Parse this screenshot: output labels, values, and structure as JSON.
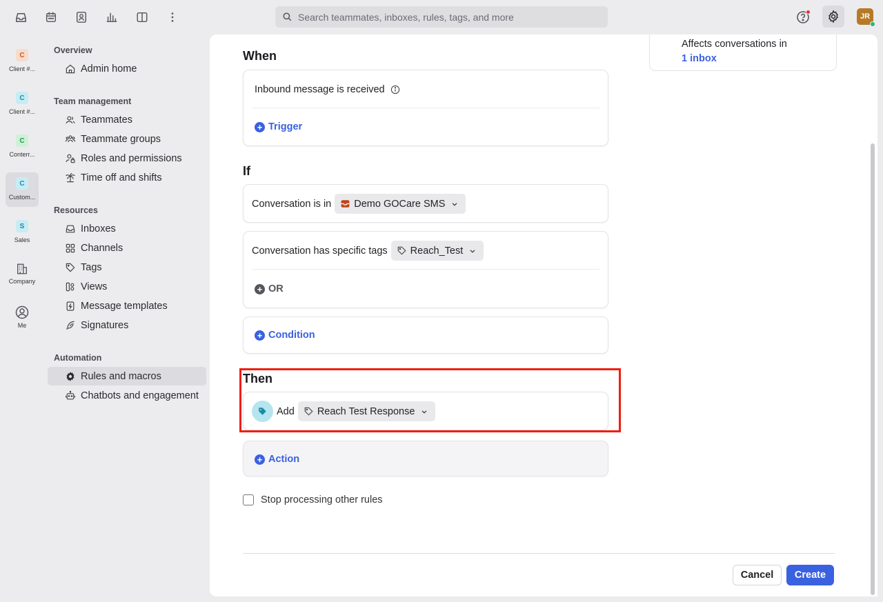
{
  "search": {
    "placeholder": "Search teammates, inboxes, rules, tags, and more"
  },
  "user": {
    "initials": "JR"
  },
  "workspaces": [
    {
      "badge": "C",
      "label": "Client #...",
      "color": "#f4d7c8",
      "text": "#d6521b"
    },
    {
      "badge": "C",
      "label": "Client #...",
      "color": "#c8ecf3",
      "text": "#1b8aa8"
    },
    {
      "badge": "C",
      "label": "Conterr...",
      "color": "#d0f0d8",
      "text": "#1f9a45"
    },
    {
      "badge": "C",
      "label": "Custom...",
      "color": "#c8ecf3",
      "text": "#1b8aa8"
    },
    {
      "badge": "S",
      "label": "Sales",
      "color": "#c8ecf3",
      "text": "#1b8aa8"
    },
    {
      "label": "Company"
    },
    {
      "label": "Me"
    }
  ],
  "nav": {
    "overview": {
      "heading": "Overview",
      "items": [
        "Admin home"
      ]
    },
    "team": {
      "heading": "Team management",
      "items": [
        "Teammates",
        "Teammate groups",
        "Roles and permissions",
        "Time off and shifts"
      ]
    },
    "resources": {
      "heading": "Resources",
      "items": [
        "Inboxes",
        "Channels",
        "Tags",
        "Views",
        "Message templates",
        "Signatures"
      ]
    },
    "automation": {
      "heading": "Automation",
      "items": [
        "Rules and macros",
        "Chatbots and engagement"
      ]
    }
  },
  "affects": {
    "text": "Affects conversations in",
    "link": "1 inbox"
  },
  "when": {
    "title": "When",
    "trigger_text": "Inbound message is received",
    "add_trigger": "Trigger"
  },
  "if": {
    "title": "If",
    "cond1_text": "Conversation is in",
    "cond1_value": "Demo GOCare SMS",
    "cond2_text": "Conversation has specific tags",
    "cond2_value": "Reach_Test",
    "or_label": "OR",
    "add_condition": "Condition"
  },
  "then": {
    "title": "Then",
    "action_verb": "Add",
    "action_value": "Reach Test Response",
    "add_action": "Action"
  },
  "stop_processing": "Stop processing other rules",
  "buttons": {
    "cancel": "Cancel",
    "create": "Create"
  }
}
